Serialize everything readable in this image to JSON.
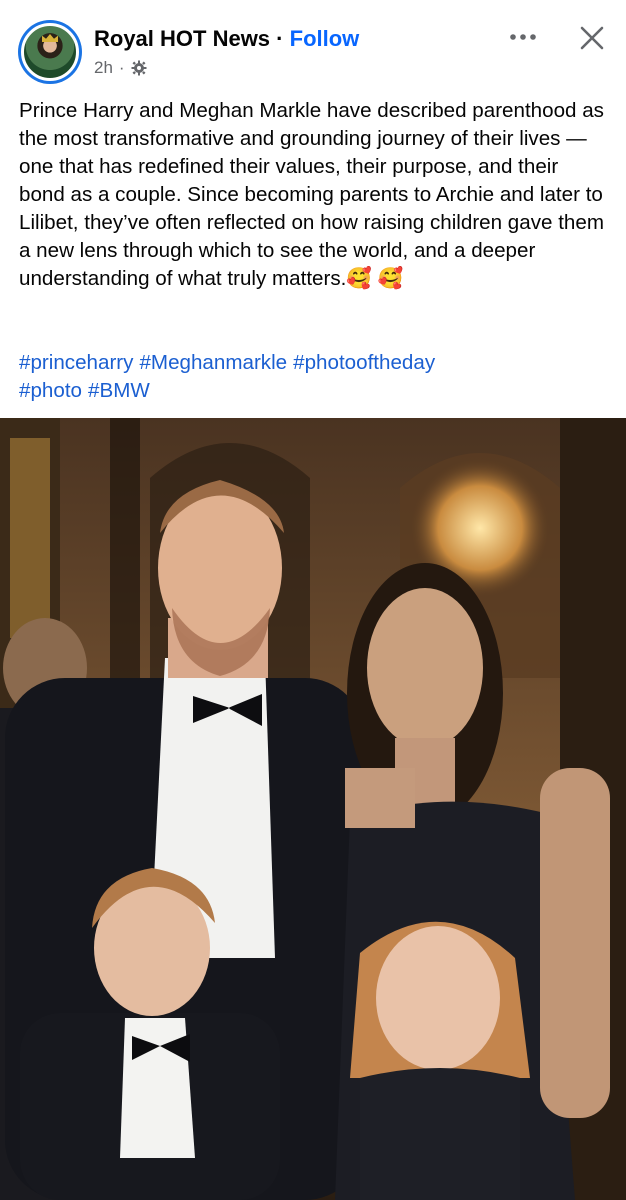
{
  "post": {
    "page_name": "Royal HOT News",
    "separator": "·",
    "follow_label": "Follow",
    "time": "2h",
    "time_separator": "·",
    "caption": "Prince Harry and Meghan Markle have described parenthood as the most transformative and grounding journey of their lives — one that has redefined their values, their purpose, and their bond as a couple. Since becoming parents to Archie and later to Lilibet, they’ve often reflected on how raising children gave them a new lens through which to see the world, and a deeper understanding of what truly matters.🥰 🥰",
    "hashtags": [
      "#princeharry",
      "#Meghanmarkle",
      "#photooftheday",
      "#photo",
      "#BMW"
    ]
  },
  "icons": {
    "privacy": "gear-icon",
    "more": "more-options-icon",
    "close": "close-icon"
  },
  "colors": {
    "follow": "#0866ff",
    "hashtag": "#1b5fd1",
    "meta": "#65676b",
    "avatar_ring": "#1b74e4"
  }
}
